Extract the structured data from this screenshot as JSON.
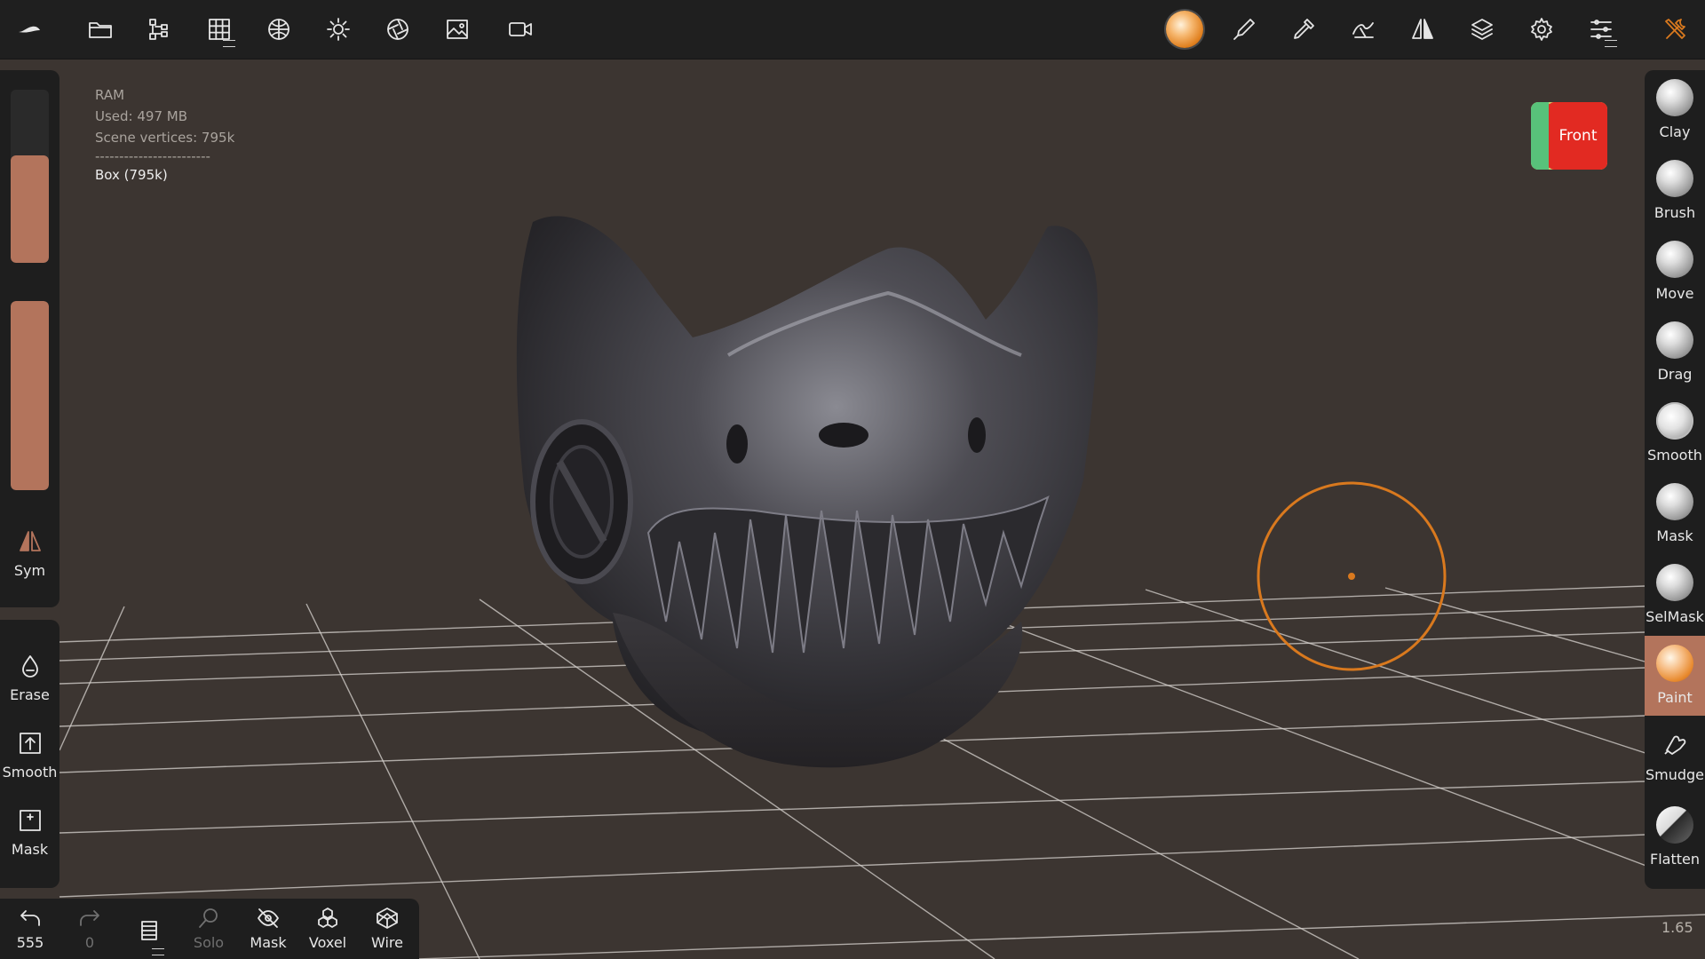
{
  "topbar": {
    "left_icons": [
      "app-logo-icon",
      "folder-icon",
      "scene-tree-icon",
      "grid-icon",
      "topology-icon",
      "light-icon",
      "aperture-icon",
      "image-icon",
      "video-camera-icon"
    ],
    "right_icons": [
      "material-sphere-icon",
      "paint-brush-icon",
      "color-picker-icon",
      "stroke-icon",
      "symmetry-icon",
      "layers-icon",
      "settings-icon",
      "sliders-icon",
      "tools-icon"
    ]
  },
  "info": {
    "ram": "RAM",
    "used": "Used: 497 MB",
    "vertices": "Scene vertices: 795k",
    "separator": "------------------------",
    "object": "Box (795k)"
  },
  "viewcube": {
    "face": "Front"
  },
  "left_panel": {
    "size_slider_level": 0.62,
    "intensity_slider_level": 1.0,
    "sym_label": "Sym",
    "tools": [
      {
        "label": "Erase",
        "icon": "drop-icon"
      },
      {
        "label": "Smooth",
        "icon": "upload-box-icon"
      },
      {
        "label": "Mask",
        "icon": "mask-box-icon"
      }
    ]
  },
  "bottombar": {
    "undo_count": "555",
    "redo_count": "0",
    "solo": "Solo",
    "mask": "Mask",
    "voxel": "Voxel",
    "wire": "Wire"
  },
  "right_tools": [
    {
      "label": "Clay",
      "active": false
    },
    {
      "label": "Brush",
      "active": false
    },
    {
      "label": "Move",
      "active": false
    },
    {
      "label": "Drag",
      "active": false
    },
    {
      "label": "Smooth",
      "active": false
    },
    {
      "label": "Mask",
      "active": false
    },
    {
      "label": "SelMask",
      "active": false
    },
    {
      "label": "Paint",
      "active": true
    },
    {
      "label": "Smudge",
      "active": false
    },
    {
      "label": "Flatten",
      "active": false
    }
  ],
  "zoom": "1.65",
  "colors": {
    "accent": "#b3745c",
    "brush_cursor": "#d9791e",
    "background": "#3c3531"
  }
}
